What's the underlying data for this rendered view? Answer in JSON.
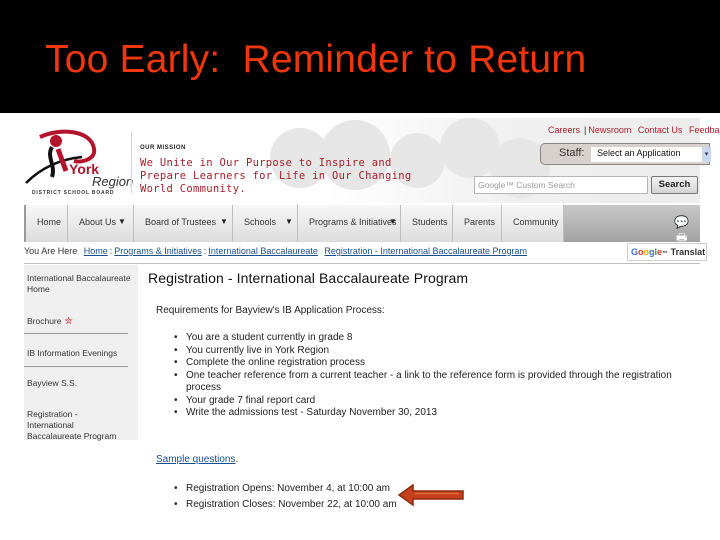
{
  "slide": {
    "title": "Too Early:  Reminder to Return",
    "title_color": "#f0360a",
    "background": "#000000"
  },
  "site": {
    "logo": {
      "york": "York",
      "region": "Region",
      "subtitle": "DISTRICT SCHOOL BOARD"
    },
    "mission_label": "OUR MISSION",
    "mission_text": "We Unite in Our Purpose to Inspire and Prepare Learners for Life in Our Changing World Community.",
    "top_links": [
      "Careers",
      "Newsroom",
      "Contact Us",
      "Feedba"
    ],
    "staff": {
      "label": "Staff:",
      "select_value": "Select an Application"
    },
    "search": {
      "placeholder": "Google™ Custom Search",
      "button_label": "Search"
    },
    "nav": [
      {
        "label": "Home",
        "dropdown": false
      },
      {
        "label": "About Us",
        "dropdown": true
      },
      {
        "label": "Board of Trustees",
        "dropdown": true
      },
      {
        "label": "Schools",
        "dropdown": true
      },
      {
        "label": "Programs & Initiatives",
        "dropdown": true
      },
      {
        "label": "Students",
        "dropdown": false
      },
      {
        "label": "Parents",
        "dropdown": false
      },
      {
        "label": "Community",
        "dropdown": false
      }
    ],
    "nav_icons": [
      "comment-icon",
      "print-icon"
    ],
    "breadcrumb": {
      "prefix": "You Are Here",
      "items": [
        "Home",
        "Programs & Initiatives",
        "International Baccalaureate",
        "Registration - International Baccalaureate Program"
      ]
    },
    "translate": {
      "label": "Translat"
    },
    "sidebar": [
      {
        "label": "International Baccalaureate Home"
      },
      {
        "label": "Brochure",
        "icon": "pdf-icon"
      },
      {
        "label": "IB Information Evenings"
      },
      {
        "label": "Bayview S.S."
      },
      {
        "label": "Registration - International Baccalaureate Program"
      }
    ],
    "main": {
      "title": "Registration - International Baccalaureate Program",
      "requirements_heading": "Requirements for Bayview's IB Application Process:",
      "requirements": [
        "You are a student currently in grade 8",
        "You currently live in York Region",
        "Complete the online registration process",
        "One teacher reference from a current teacher - a link to the reference form is provided through the registration process",
        "Your grade 7 final report card",
        "Write the admissions test - Saturday November 30, 2013"
      ],
      "sample_link": "Sample questions",
      "sample_suffix": ".",
      "dates": [
        "Registration Opens: November 4, at 10:00 am",
        "Registration Closes: November 22, at 10:00 am"
      ]
    },
    "callout_color": "#c4401a"
  }
}
